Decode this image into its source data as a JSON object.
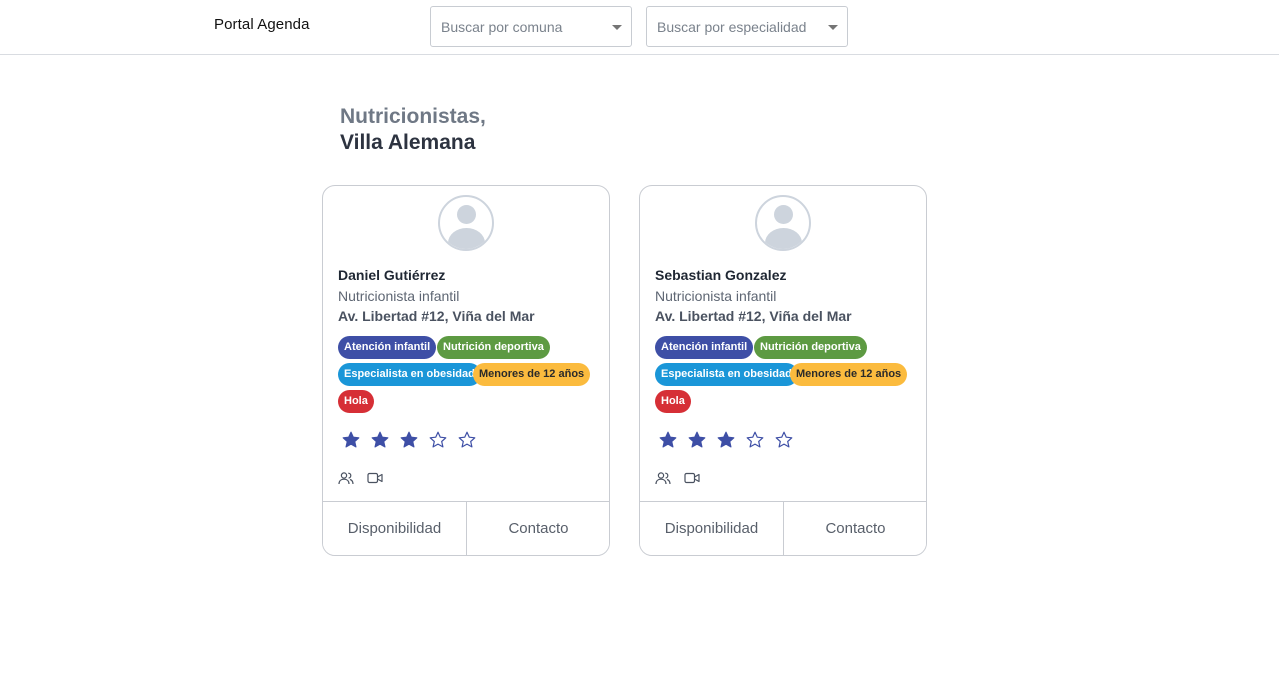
{
  "header": {
    "brand": "Portal Agenda",
    "comuna_placeholder": "Buscar por comuna",
    "especialidad_placeholder": "Buscar por especialidad"
  },
  "page": {
    "specialty_line": "Nutricionistas,",
    "location_line": "Villa Alemana"
  },
  "colors": {
    "tag_blue": "#3e4fa6",
    "tag_green": "#5d9a42",
    "tag_lightblue": "#1a96d8",
    "tag_yellow": "#fbbb3e",
    "tag_red": "#d62f36",
    "star": "#3e4fa6"
  },
  "professionals": [
    {
      "name": "Daniel Gutiérrez",
      "role": "Nutricionista infantil",
      "address": "Av. Libertad #12, Viña del Mar",
      "tags": [
        "Atención infantil",
        "Nutrición deportiva",
        "Especialista en obesidad",
        "Menores de 12 años",
        "Hola"
      ],
      "rating": 3,
      "rating_max": 5,
      "modalities": [
        "group-icon",
        "video-icon"
      ],
      "availability_label": "Disponibilidad",
      "contact_label": "Contacto"
    },
    {
      "name": "Sebastian Gonzalez",
      "role": "Nutricionista infantil",
      "address": "Av. Libertad #12, Viña del Mar",
      "tags": [
        "Atención infantil",
        "Nutrición deportiva",
        "Especialista en obesidad",
        "Menores de 12 años",
        "Hola"
      ],
      "rating": 3,
      "rating_max": 5,
      "modalities": [
        "group-icon",
        "video-icon"
      ],
      "availability_label": "Disponibilidad",
      "contact_label": "Contacto"
    }
  ]
}
